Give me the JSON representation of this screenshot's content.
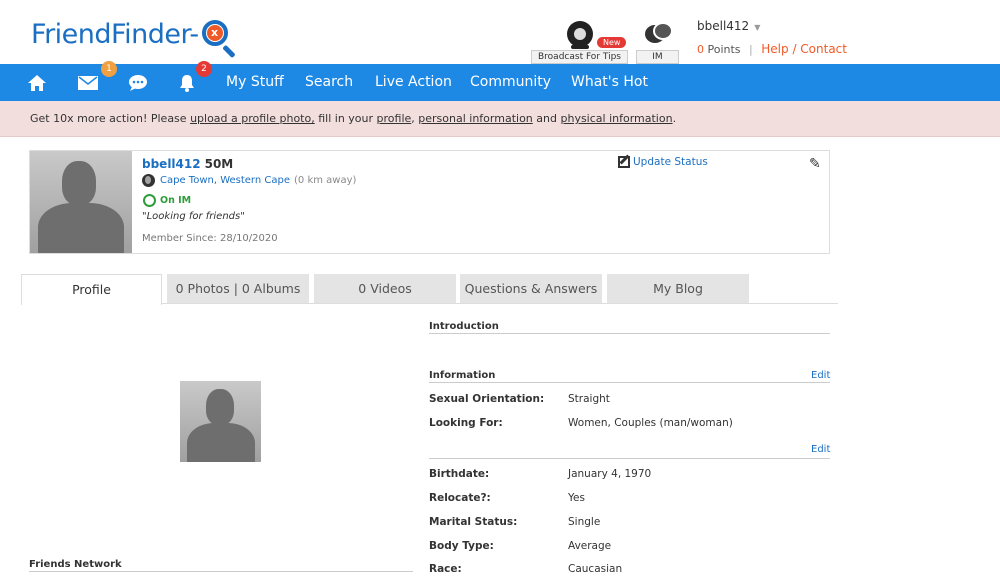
{
  "header": {
    "logo_text": "FriendFinder-",
    "logo_badge": "x",
    "broadcast_label": "Broadcast For Tips",
    "broadcast_badge": "New",
    "im_label": "IM",
    "username": "bbell412",
    "points_value": "0",
    "points_label": "Points",
    "separator": "|",
    "help_contact": "Help / Contact"
  },
  "nav": {
    "mail_badge": "1",
    "alerts_badge": "2",
    "items": [
      {
        "label": "My Stuff"
      },
      {
        "label": "Search"
      },
      {
        "label": "Live Action"
      },
      {
        "label": "Community"
      },
      {
        "label": "What's Hot"
      }
    ],
    "colors": {
      "bar": "#1e88e5",
      "mail_badge": "#f0a040",
      "alerts_badge": "#e53935"
    }
  },
  "alert": {
    "prefix": "Get 10x more action! Please ",
    "link1": "upload a profile photo,",
    "mid1": " fill in your ",
    "link2": "profile",
    "mid2": ", ",
    "link3": "personal information",
    "mid3": " and ",
    "link4": "physical information",
    "suffix": "."
  },
  "profile_card": {
    "username": "bbell412",
    "age_gender": "50M",
    "location": "Cape Town, Western Cape",
    "distance": "(0 km away)",
    "im_status": "On IM",
    "quote": "\"Looking for friends\"",
    "member_since": "Member Since: 28/10/2020",
    "update_status": "Update Status"
  },
  "tabs": [
    {
      "label": "Profile",
      "active": true
    },
    {
      "label": "0 Photos | 0 Albums",
      "active": false
    },
    {
      "label": "0 Videos",
      "active": false
    },
    {
      "label": "Questions & Answers",
      "active": false
    },
    {
      "label": "My Blog",
      "active": false
    }
  ],
  "left": {
    "friends_network": "Friends Network"
  },
  "right": {
    "introduction": "Introduction",
    "information": "Information",
    "edit": "Edit",
    "rows_group1": [
      {
        "label": "Sexual Orientation:",
        "value": "Straight"
      },
      {
        "label": "Looking For:",
        "value": "Women, Couples (man/woman)"
      }
    ],
    "rows_group2": [
      {
        "label": "Birthdate:",
        "value": "January 4, 1970"
      },
      {
        "label": "Relocate?:",
        "value": "Yes"
      },
      {
        "label": "Marital Status:",
        "value": "Single"
      },
      {
        "label": "Body Type:",
        "value": "Average"
      },
      {
        "label": "Race:",
        "value": "Caucasian"
      }
    ]
  }
}
